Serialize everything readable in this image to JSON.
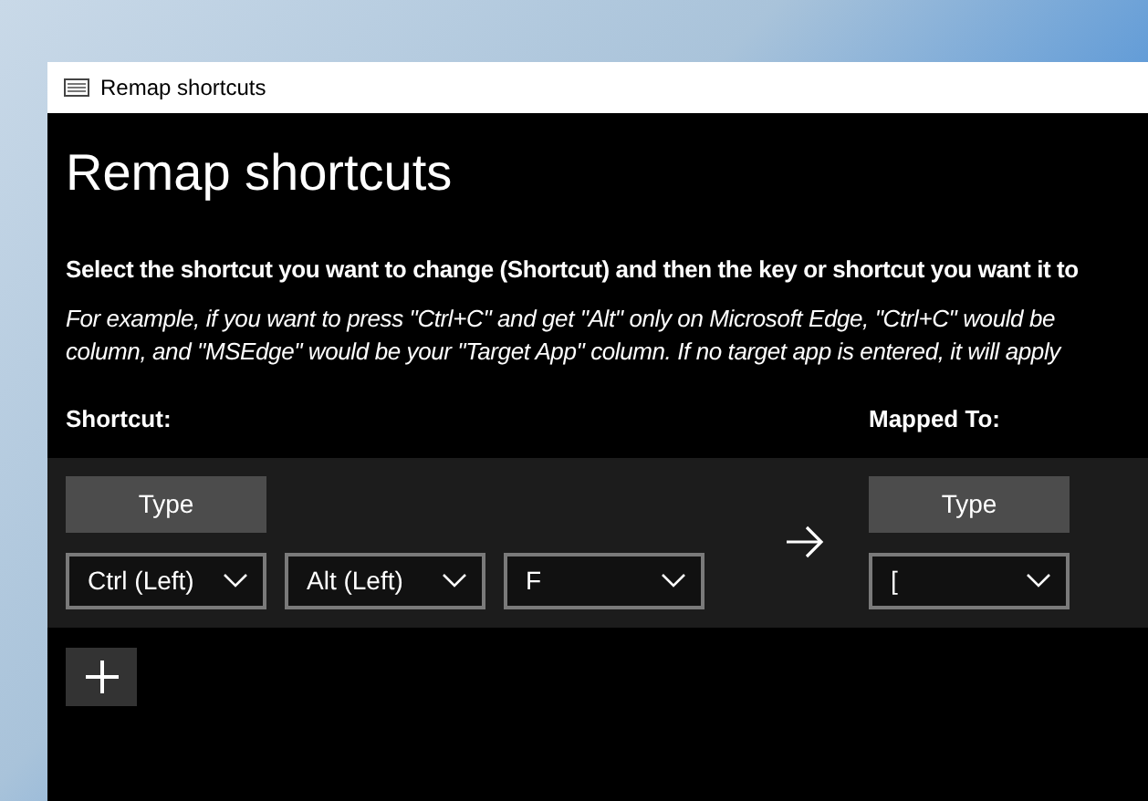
{
  "window": {
    "title": "Remap shortcuts"
  },
  "heading": "Remap shortcuts",
  "instruction": "Select the shortcut you want to change (Shortcut) and then the key or shortcut you want it to",
  "example_lines": [
    "For example, if you want to press \"Ctrl+C\" and get \"Alt\" only on Microsoft Edge, \"Ctrl+C\" would be",
    "column, and \"MSEdge\" would be your \"Target App\" column. If no target app is entered, it will apply"
  ],
  "columns": {
    "shortcut": "Shortcut:",
    "mapped_to": "Mapped To:"
  },
  "mapping_rows": [
    {
      "shortcut": {
        "type_button": "Type",
        "keys": [
          "Ctrl (Left)",
          "Alt (Left)",
          "F"
        ]
      },
      "mapped_to": {
        "type_button": "Type",
        "keys": [
          "["
        ]
      }
    }
  ]
}
